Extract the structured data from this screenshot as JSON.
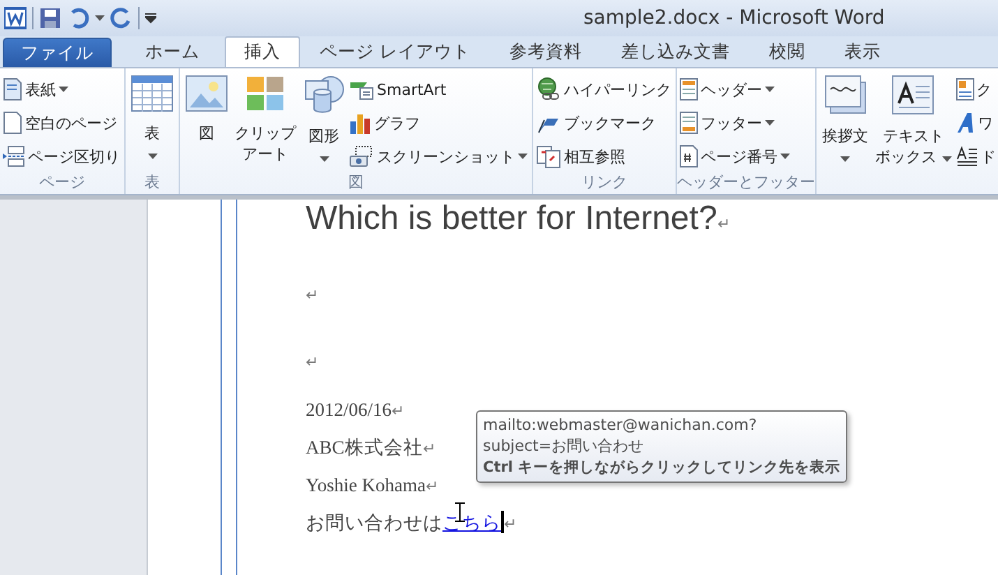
{
  "title_bar": {
    "title": "sample2.docx - Microsoft Word"
  },
  "tabs": [
    {
      "label": "ファイル",
      "kind": "file",
      "selected": false
    },
    {
      "label": "ホーム",
      "kind": "tab",
      "selected": false
    },
    {
      "label": "挿入",
      "kind": "tab",
      "selected": true
    },
    {
      "label": "ページ レイアウト",
      "kind": "tab",
      "selected": false
    },
    {
      "label": "参考資料",
      "kind": "tab",
      "selected": false
    },
    {
      "label": "差し込み文書",
      "kind": "tab",
      "selected": false
    },
    {
      "label": "校閲",
      "kind": "tab",
      "selected": false
    },
    {
      "label": "表示",
      "kind": "tab",
      "selected": false
    }
  ],
  "ribbon": {
    "groups": [
      {
        "label": "ページ",
        "items": [
          {
            "kind": "stack",
            "items": [
              {
                "label": "表紙",
                "dropdown": true
              },
              {
                "label": "空白のページ",
                "dropdown": false
              },
              {
                "label": "ページ区切り",
                "dropdown": false
              }
            ]
          }
        ]
      },
      {
        "label": "表",
        "items": [
          {
            "kind": "large",
            "lines": [
              "表"
            ],
            "dropdown": true
          }
        ]
      },
      {
        "label": "図",
        "items": [
          {
            "kind": "large",
            "lines": [
              "図"
            ],
            "dropdown": false
          },
          {
            "kind": "large",
            "lines": [
              "クリップ",
              "アート"
            ],
            "dropdown": false
          },
          {
            "kind": "large",
            "lines": [
              "図形"
            ],
            "dropdown": true
          },
          {
            "kind": "stack",
            "items": [
              {
                "label": "SmartArt",
                "dropdown": false
              },
              {
                "label": "グラフ",
                "dropdown": false
              },
              {
                "label": "スクリーンショット",
                "dropdown": true
              }
            ]
          }
        ]
      },
      {
        "label": "リンク",
        "items": [
          {
            "kind": "stack",
            "items": [
              {
                "label": "ハイパーリンク",
                "dropdown": false
              },
              {
                "label": "ブックマーク",
                "dropdown": false
              },
              {
                "label": "相互参照",
                "dropdown": false
              }
            ]
          }
        ]
      },
      {
        "label": "ヘッダーとフッター",
        "items": [
          {
            "kind": "stack",
            "items": [
              {
                "label": "ヘッダー",
                "dropdown": true
              },
              {
                "label": "フッター",
                "dropdown": true
              },
              {
                "label": "ページ番号",
                "dropdown": true
              }
            ]
          }
        ]
      },
      {
        "items": [
          {
            "kind": "large",
            "lines": [
              "挨拶文"
            ],
            "dropdown": true
          },
          {
            "kind": "large",
            "lines": [
              "テキスト",
              "ボックス"
            ],
            "dropdown": true
          },
          {
            "kind": "stack",
            "items": [
              {
                "label": "ク",
                "dropdown": false
              },
              {
                "label": "ワ",
                "dropdown": false
              },
              {
                "label": "ド",
                "dropdown": false
              }
            ]
          }
        ]
      }
    ]
  },
  "document": {
    "paragraphs": [
      {
        "kind": "heading",
        "text": "Which is better for Internet?",
        "mark": "↵"
      },
      {
        "kind": "empty",
        "mark": "↵"
      },
      {
        "kind": "empty",
        "mark": "↵"
      },
      {
        "kind": "body",
        "text": "2012/06/16",
        "mark": "↵"
      },
      {
        "kind": "body",
        "text": "ABC株式会社",
        "mark": "↵"
      },
      {
        "kind": "body",
        "text": "Yoshie Kohama",
        "mark": "↵"
      },
      {
        "kind": "body",
        "text": "お問い合わせは",
        "link": "こちら",
        "mark": "↵",
        "cursor": true
      }
    ]
  },
  "tooltip": {
    "lines": [
      "mailto:webmaster@wanichan.com?",
      "subject=お問い合わせ"
    ],
    "hint": "Ctrl キーを押しながらクリックしてリンク先を表示"
  }
}
